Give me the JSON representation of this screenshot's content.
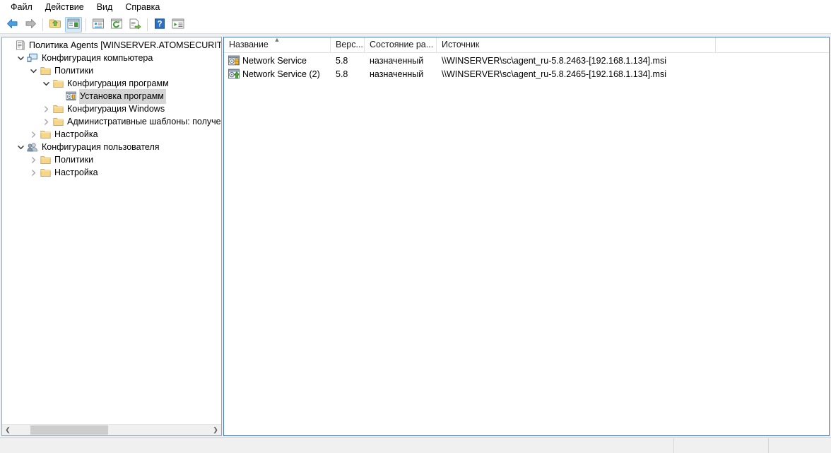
{
  "window": {
    "title": "Политика Agents [WINSERVER.ATOMSECURITY.COM]"
  },
  "menu": {
    "items": [
      {
        "label": "Файл",
        "name": "menu-file"
      },
      {
        "label": "Действие",
        "name": "menu-action"
      },
      {
        "label": "Вид",
        "name": "menu-view"
      },
      {
        "label": "Справка",
        "name": "menu-help"
      }
    ]
  },
  "toolbar": {
    "buttons": [
      {
        "icon": "back-arrow-icon",
        "name": "toolbar-back",
        "active": false
      },
      {
        "icon": "forward-arrow-icon",
        "name": "toolbar-forward",
        "active": false
      },
      {
        "icon": "up-folder-icon",
        "name": "toolbar-up-one-level",
        "active": false
      },
      {
        "icon": "show-console-tree-icon",
        "name": "toolbar-show-tree",
        "active": true
      },
      {
        "icon": "properties-icon",
        "name": "toolbar-properties",
        "active": false
      },
      {
        "icon": "refresh-icon",
        "name": "toolbar-refresh",
        "active": false
      },
      {
        "icon": "export-list-icon",
        "name": "toolbar-export-list",
        "active": false
      },
      {
        "icon": "help-icon",
        "name": "toolbar-help",
        "active": false
      },
      {
        "icon": "show-action-pane-icon",
        "name": "toolbar-show-action-pane",
        "active": false
      }
    ]
  },
  "tree": {
    "nodes": [
      {
        "label": "Политика Agents [WINSERVER.ATOMSECURITY.COM]",
        "depth": 0,
        "twist": "none",
        "icon": "policy-icon",
        "selected": false,
        "name": "tree-item-policy-root"
      },
      {
        "label": "Конфигурация компьютера",
        "depth": 1,
        "twist": "expanded",
        "icon": "computer-icon",
        "selected": false,
        "name": "tree-item-computer-configuration"
      },
      {
        "label": "Политики",
        "depth": 2,
        "twist": "expanded",
        "icon": "folder-icon",
        "selected": false,
        "name": "tree-item-computer-policies"
      },
      {
        "label": "Конфигурация программ",
        "depth": 3,
        "twist": "expanded",
        "icon": "folder-icon",
        "selected": false,
        "name": "tree-item-software-settings"
      },
      {
        "label": "Установка программ",
        "depth": 4,
        "twist": "none",
        "icon": "package-icon",
        "selected": true,
        "name": "tree-item-software-installation"
      },
      {
        "label": "Конфигурация Windows",
        "depth": 3,
        "twist": "collapsed",
        "icon": "folder-icon",
        "selected": false,
        "name": "tree-item-windows-settings"
      },
      {
        "label": "Административные шаблоны: получены",
        "depth": 3,
        "twist": "collapsed",
        "icon": "folder-icon",
        "selected": false,
        "name": "tree-item-administrative-templates"
      },
      {
        "label": "Настройка",
        "depth": 2,
        "twist": "collapsed",
        "icon": "folder-icon",
        "selected": false,
        "name": "tree-item-computer-preferences"
      },
      {
        "label": "Конфигурация пользователя",
        "depth": 1,
        "twist": "expanded",
        "icon": "user-icon",
        "selected": false,
        "name": "tree-item-user-configuration"
      },
      {
        "label": "Политики",
        "depth": 2,
        "twist": "collapsed",
        "icon": "folder-icon",
        "selected": false,
        "name": "tree-item-user-policies"
      },
      {
        "label": "Настройка",
        "depth": 2,
        "twist": "collapsed",
        "icon": "folder-icon",
        "selected": false,
        "name": "tree-item-user-preferences"
      }
    ]
  },
  "list": {
    "sort_column": "Название",
    "sort_direction": "ascending",
    "columns": [
      {
        "label": "Название",
        "name": "column-header-name"
      },
      {
        "label": "Верс...",
        "name": "column-header-version"
      },
      {
        "label": "Состояние ра...",
        "name": "column-header-deployment-state"
      },
      {
        "label": "Источник",
        "name": "column-header-source"
      }
    ],
    "rows": [
      {
        "icon": "msi-package-assigned-icon",
        "name": "Network Service",
        "version": "5.8",
        "state": "назначенный",
        "source": "\\\\WINSERVER\\sc\\agent_ru-5.8.2463-[192.168.1.134].msi"
      },
      {
        "icon": "msi-package-upgrade-icon",
        "name": "Network Service (2)",
        "version": "5.8",
        "state": "назначенный",
        "source": "\\\\WINSERVER\\sc\\agent_ru-5.8.2465-[192.168.1.134].msi"
      }
    ]
  },
  "statusbar": {
    "main": "",
    "cell_b": "",
    "cell_c": ""
  },
  "colors": {
    "selection_inactive": "#d6d6d6",
    "list_pane_border": "#4a7eb5",
    "tree_pane_border": "#9aa7b0",
    "toolbar_active": "#d6ebf9",
    "folder": "#f5d68a"
  }
}
